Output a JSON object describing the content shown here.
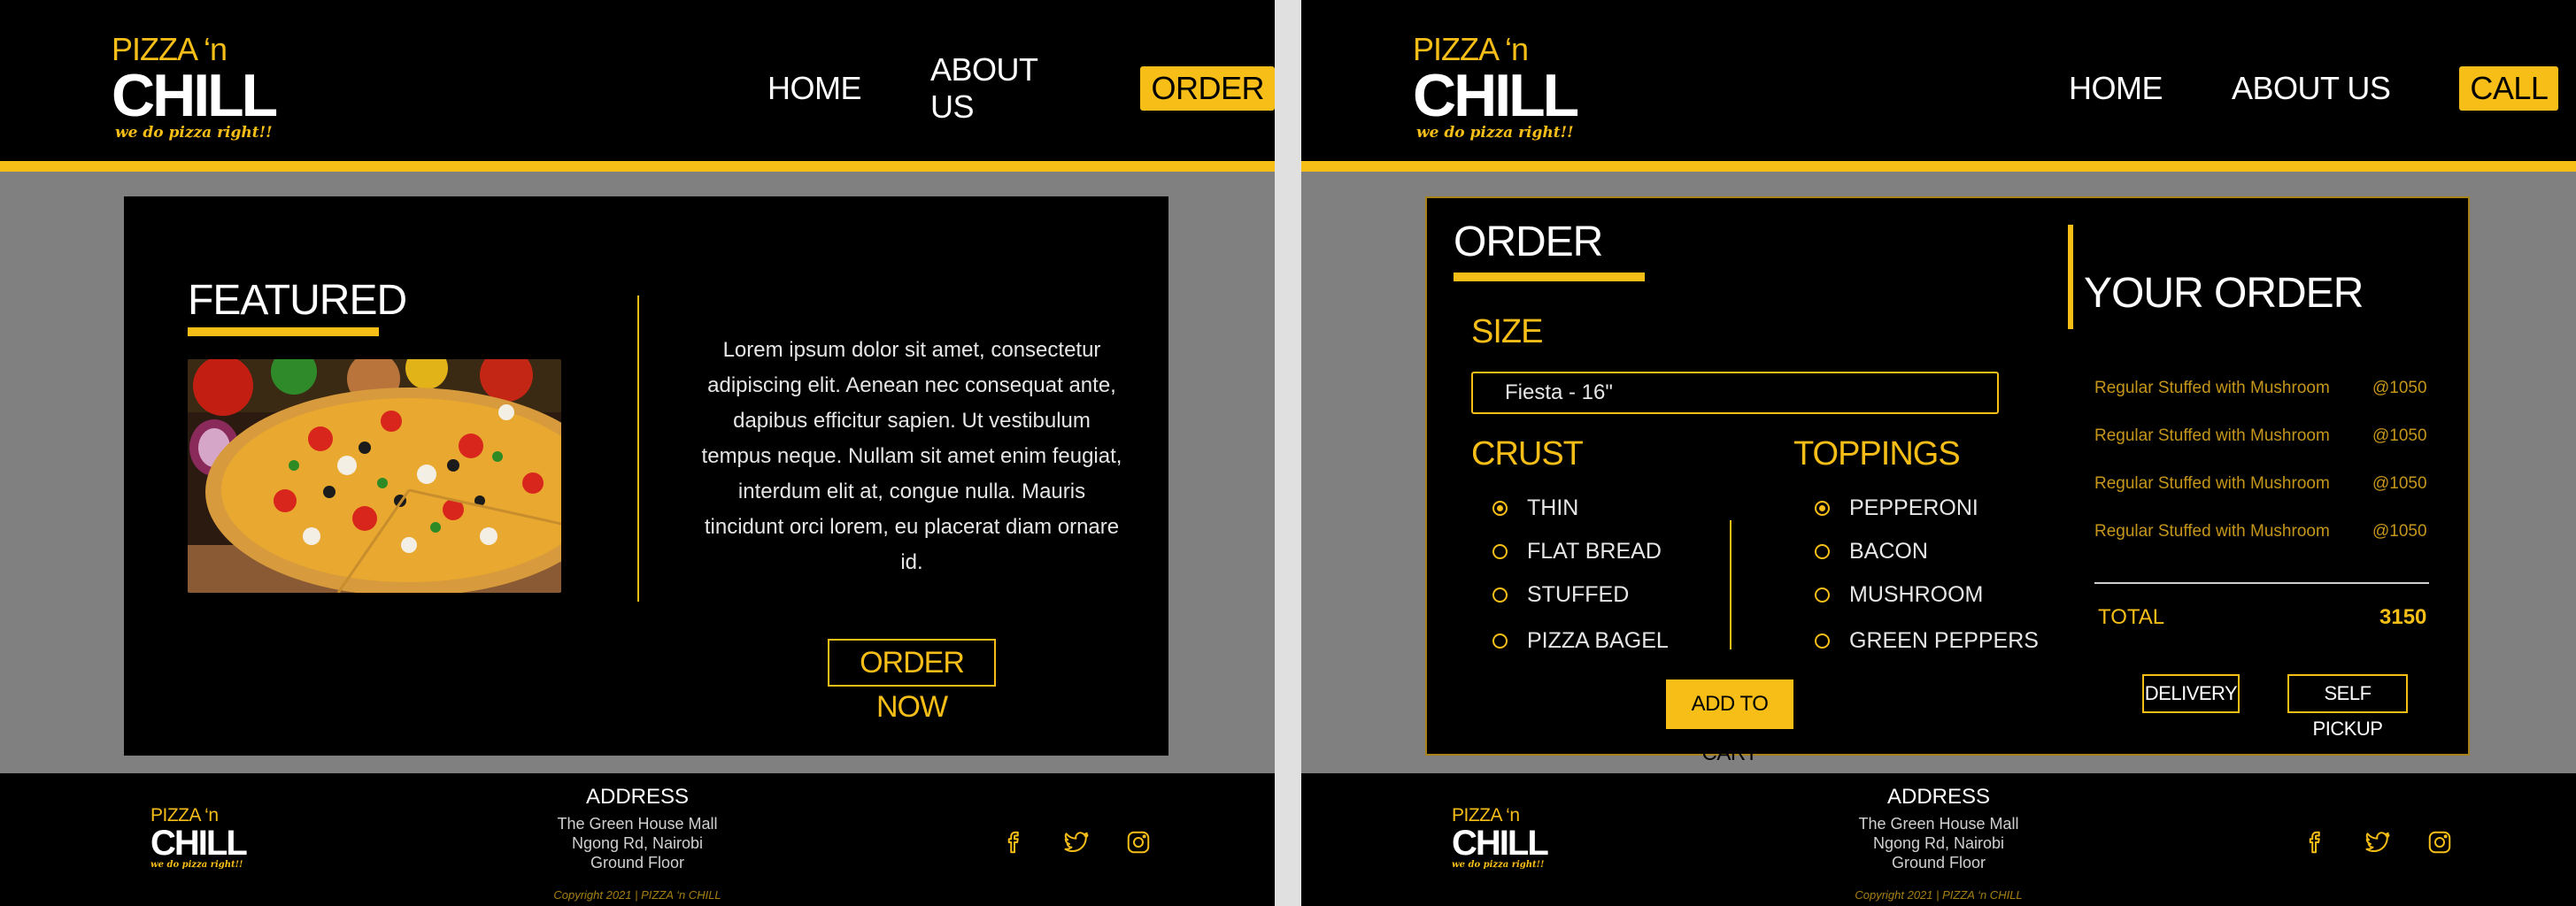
{
  "brand": {
    "line1": "PIZZA ‘n",
    "line2": "CHILL",
    "tagline": "we do pizza right!!"
  },
  "left_screen": {
    "nav": {
      "home": "HOME",
      "about": "ABOUT US",
      "cta": "ORDER"
    },
    "featured": {
      "title": "FEATURED",
      "body": "Lorem ipsum dolor sit amet, consectetur adipiscing elit. Aenean nec consequat ante, dapibus efficitur sapien. Ut vestibulum tempus neque. Nullam sit amet enim feugiat, interdum elit at, congue nulla. Mauris tincidunt orci lorem, eu placerat diam ornare id.",
      "button": "ORDER NOW"
    }
  },
  "right_screen": {
    "nav": {
      "home": "HOME",
      "about": "ABOUT US",
      "cta": "CALL"
    },
    "order": {
      "title": "ORDER",
      "size_label": "SIZE",
      "size_value": "Fiesta - 16\"",
      "crust_label": "CRUST",
      "crust_options": [
        "THIN",
        "FLAT BREAD",
        "STUFFED",
        "PIZZA BAGEL"
      ],
      "crust_selected": "THIN",
      "toppings_label": "TOPPINGS",
      "topping_options": [
        "PEPPERONI",
        "BACON",
        "MUSHROOM",
        "GREEN PEPPERS"
      ],
      "topping_selected": "PEPPERONI",
      "add_to_cart": "ADD TO CART"
    },
    "your_order": {
      "title": "YOUR ORDER",
      "items": [
        {
          "name": "Regular Stuffed with Mushroom",
          "price": "@1050"
        },
        {
          "name": "Regular Stuffed with Mushroom",
          "price": "@1050"
        },
        {
          "name": "Regular Stuffed with Mushroom",
          "price": "@1050"
        },
        {
          "name": "Regular Stuffed with Mushroom",
          "price": "@1050"
        }
      ],
      "total_label": "TOTAL",
      "total_value": "3150",
      "delivery": "DELIVERY",
      "self_pickup": "SELF PICKUP"
    }
  },
  "footer": {
    "address_title": "ADDRESS",
    "address_lines": [
      "The Green House Mall",
      "Ngong Rd, Nairobi",
      "Ground Floor"
    ],
    "copyright": "Copyright 2021 | PIZZA ‘n CHILL",
    "social_icons": [
      "facebook-icon",
      "twitter-icon",
      "instagram-icon"
    ]
  },
  "colors": {
    "accent": "#f6be16",
    "header_bg": "#000000",
    "page_bg": "#808080",
    "text": "#ffffff"
  }
}
